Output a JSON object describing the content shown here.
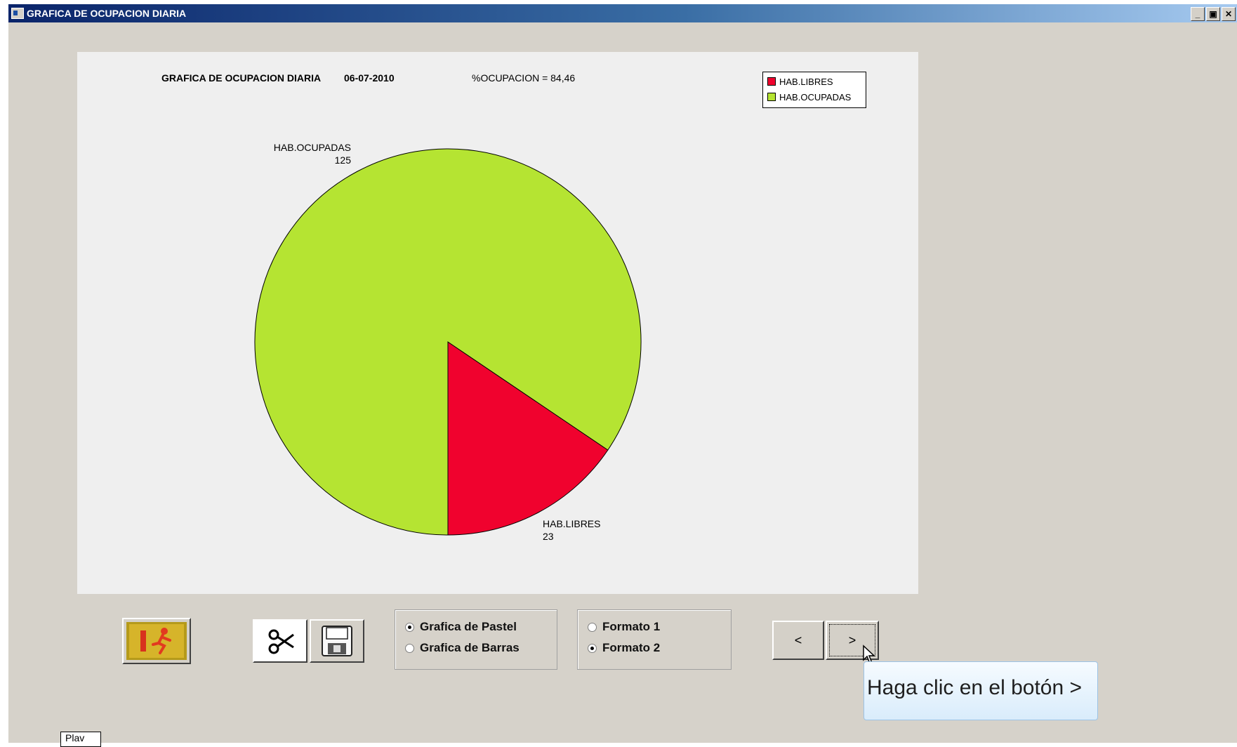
{
  "window": {
    "title": "GRAFICA DE OCUPACION DIARIA",
    "minimize": "_",
    "restore": "▣",
    "close": "✕"
  },
  "chart_header": {
    "title": "GRAFICA DE OCUPACION DIARIA",
    "date": "06-07-2010",
    "occupancy_label": "%OCUPACION  =  84,46"
  },
  "chart_data": {
    "type": "pie",
    "title": "GRAFICA DE OCUPACION DIARIA",
    "slices": [
      {
        "label": "HAB.LIBRES",
        "value": 23,
        "color": "#f0022e"
      },
      {
        "label": "HAB.OCUPADAS",
        "value": 125,
        "color": "#b5e432"
      }
    ],
    "legend": [
      "HAB.LIBRES",
      "HAB.OCUPADAS"
    ],
    "legend_position": "top-right"
  },
  "slice_labels": {
    "ocupadas_name": "HAB.OCUPADAS",
    "ocupadas_value": "125",
    "libres_name": "HAB.LIBRES",
    "libres_value": "23"
  },
  "chart_type_group": {
    "options": [
      "Grafica de Pastel",
      "Grafica de Barras"
    ],
    "selected": "Grafica de Pastel"
  },
  "format_group": {
    "options": [
      "Formato 1",
      "Formato 2"
    ],
    "selected": "Formato 2"
  },
  "nav": {
    "prev": "<",
    "next": ">"
  },
  "tooltip": "Haga clic en el botón >",
  "taskbar_item": "Plav"
}
